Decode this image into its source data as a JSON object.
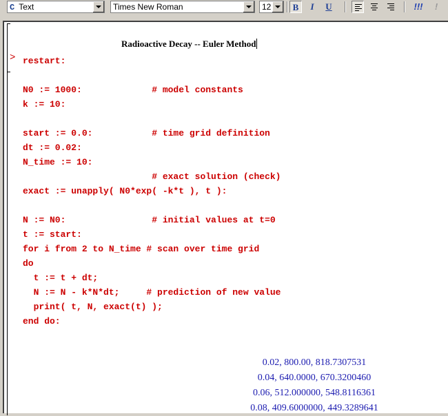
{
  "toolbar": {
    "style_icon": "C",
    "style_value": "Text",
    "font_value": "Times New Roman",
    "size_value": "12",
    "bold_label": "B",
    "italic_label": "I",
    "underline_label": "U",
    "exec_label": "!!!",
    "exec_one_label": "!"
  },
  "worksheet": {
    "title": "Radioactive Decay  --  Euler Method",
    "prompt": ">",
    "code_lines": [
      "restart:",
      "",
      "N0 := 1000:             # model constants",
      "k := 10:",
      "",
      "start := 0.0:           # time grid definition",
      "dt := 0.02:",
      "N_time := 10:",
      "                        # exact solution (check)",
      "exact := unapply( N0*exp( -k*t ), t ):",
      "",
      "N := N0:                # initial values at t=0",
      "t := start:",
      "for i from 2 to N_time # scan over time grid",
      "do",
      "  t := t + dt;",
      "  N := N - k*N*dt;     # prediction of new value",
      "  print( t, N, exact(t) );",
      "end do:"
    ],
    "output_lines": [
      "0.02, 800.00, 818.7307531",
      "0.04, 640.0000, 670.3200460",
      "0.06, 512.000000, 548.8116361",
      "0.08, 409.6000000, 449.3289641"
    ]
  }
}
